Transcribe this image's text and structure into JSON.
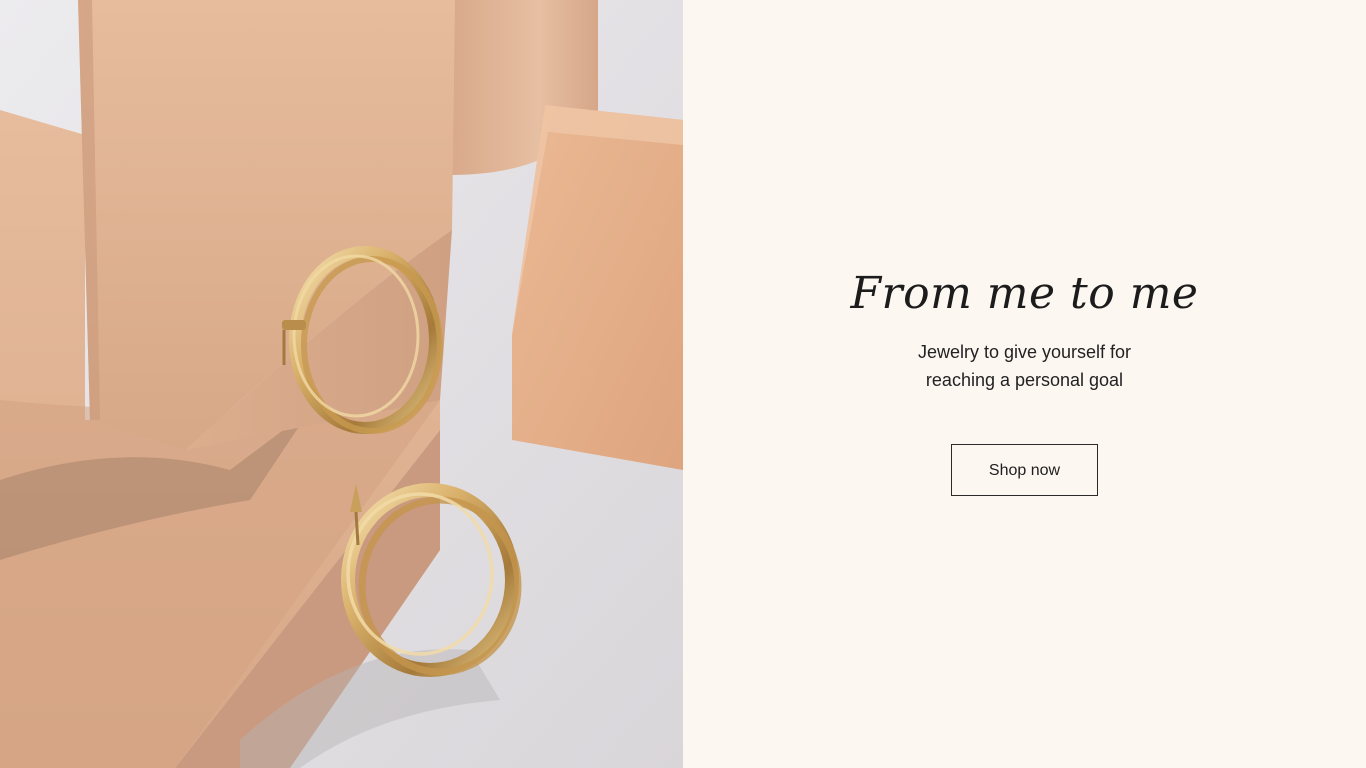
{
  "hero": {
    "image": {
      "subject": "gold hoop earrings on beige blocks"
    },
    "headline": "From me to me",
    "subtext": "Jewelry to give yourself for reaching a personal goal",
    "cta_label": "Shop now"
  },
  "colors": {
    "panel_background": "#fdf7f2",
    "text": "#1c1c1c",
    "button_border": "#2a2a2a",
    "block_beige": "#e0b493",
    "gold": "#d7ae63"
  }
}
